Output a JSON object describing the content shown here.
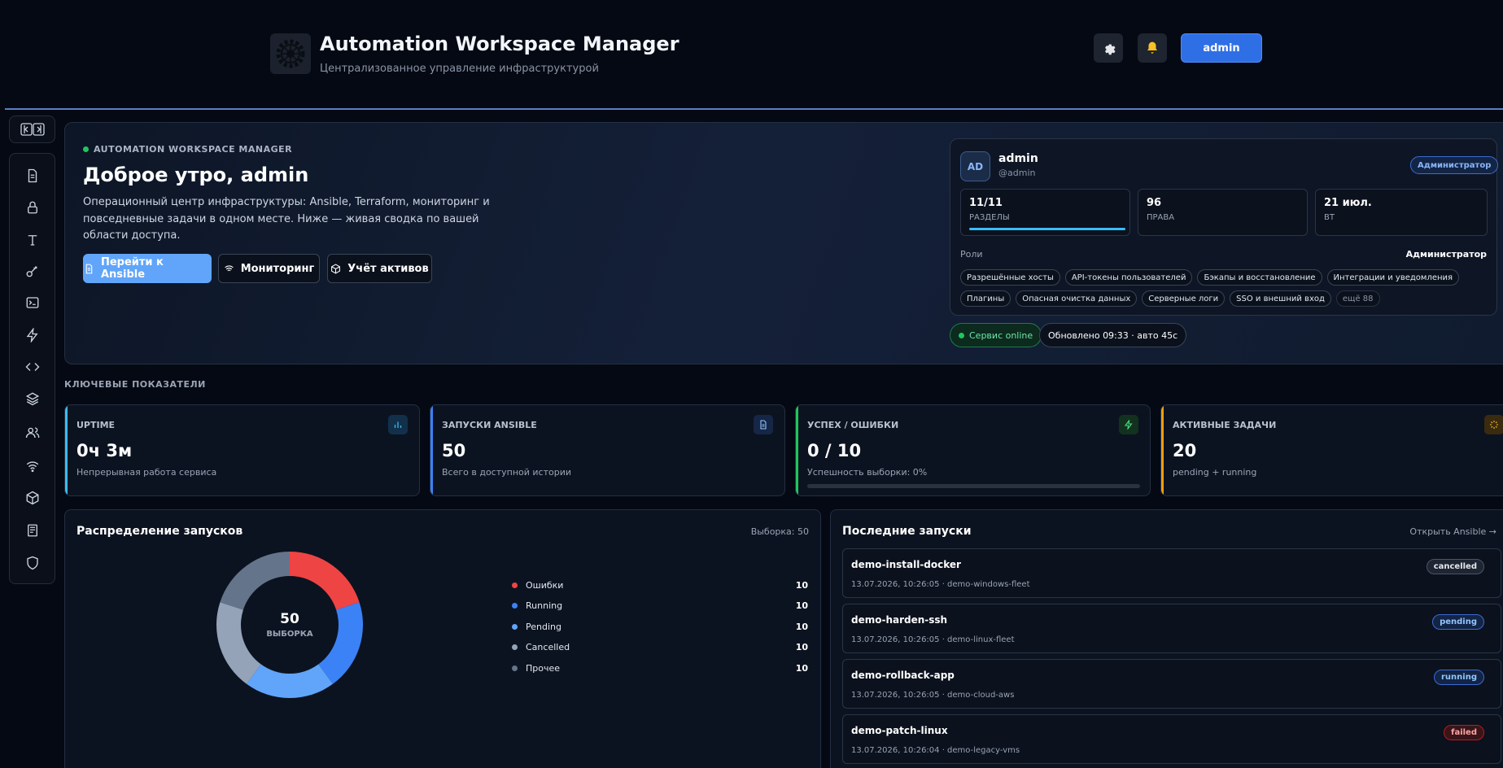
{
  "header": {
    "title": "Automation Workspace Manager",
    "subtitle": "Централизованное управление инфраструктурой",
    "user_label": "admin"
  },
  "sidebar": {
    "items": [
      "document-icon",
      "lock-icon",
      "type-icon",
      "key-icon",
      "terminal-icon",
      "bolt-icon",
      "code-icon",
      "layers-icon",
      "users-icon",
      "wifi-icon",
      "box-icon",
      "book-icon",
      "shield-icon"
    ]
  },
  "hero": {
    "tag": "AUTOMATION WORKSPACE MANAGER",
    "greeting": "Доброе утро, admin",
    "description": "Операционный центр инфраструктуры: Ansible, Terraform, мониторинг и повседневные задачи в одном месте. Ниже — живая сводка по вашей области доступа.",
    "btn_ansible": "Перейти к Ansible",
    "btn_monitoring": "Мониторинг",
    "btn_assets": "Учёт активов"
  },
  "profile": {
    "initials": "AD",
    "name": "admin",
    "handle": "@admin",
    "role_badge": "Администратор",
    "stats": [
      {
        "value": "11/11",
        "label": "РАЗДЕЛЫ",
        "fill": 1.0
      },
      {
        "value": "96",
        "label": "ПРАВА"
      },
      {
        "value": "21 июл.",
        "label": "ВТ"
      }
    ],
    "roles_label": "Роли",
    "roles_value": "Администратор",
    "permissions": [
      "Разрешённые хосты",
      "API-токены пользователей",
      "Бэкапы и восстановление",
      "Интеграции и уведомления",
      "Плагины",
      "Опасная очистка данных",
      "Серверные логи",
      "SSO и внешний вход"
    ],
    "more": "ещё 88"
  },
  "status": {
    "online": "Сервис online",
    "updated": "Обновлено 09:33 · авто 45с"
  },
  "kpi_label": "КЛЮЧЕВЫЕ ПОКАЗАТЕЛИ",
  "kpis": [
    {
      "title": "UPTIME",
      "value": "0ч 3м",
      "sub": "Непрерывная работа сервиса",
      "color": "#38bdf8",
      "icon": "chart-icon"
    },
    {
      "title": "ЗАПУСКИ ANSIBLE",
      "value": "50",
      "sub": "Всего в доступной истории",
      "color": "#3b82f6",
      "icon": "document-icon"
    },
    {
      "title": "УСПЕХ / ОШИБКИ",
      "value": "0 / 10",
      "sub": "Успешность выборки: 0%",
      "color": "#22c55e",
      "icon": "bolt-icon",
      "progress": 0
    },
    {
      "title": "АКТИВНЫЕ ЗАДАЧИ",
      "value": "20",
      "sub": "pending + running",
      "color": "#f59e0b",
      "icon": "spinner-icon"
    }
  ],
  "distribution": {
    "title": "Распределение запусков",
    "sample": "Выборка: 50",
    "center_value": "50",
    "center_label": "ВЫБОРКА"
  },
  "chart_data": {
    "type": "pie",
    "categories": [
      "Ошибки",
      "Running",
      "Pending",
      "Cancelled",
      "Прочее"
    ],
    "values": [
      10,
      10,
      10,
      10,
      10
    ],
    "colors": [
      "#ef4444",
      "#3b82f6",
      "#60a5fa",
      "#94a3b8",
      "#64748b"
    ]
  },
  "recent": {
    "title": "Последние запуски",
    "link": "Открыть Ansible →",
    "runs": [
      {
        "name": "demo-install-docker",
        "meta": "13.07.2026, 10:26:05 · demo-windows-fleet",
        "status": "cancelled"
      },
      {
        "name": "demo-harden-ssh",
        "meta": "13.07.2026, 10:26:05 · demo-linux-fleet",
        "status": "pending"
      },
      {
        "name": "demo-rollback-app",
        "meta": "13.07.2026, 10:26:05 · demo-cloud-aws",
        "status": "running"
      },
      {
        "name": "demo-patch-linux",
        "meta": "13.07.2026, 10:26:04 · demo-legacy-vms",
        "status": "failed"
      }
    ]
  }
}
